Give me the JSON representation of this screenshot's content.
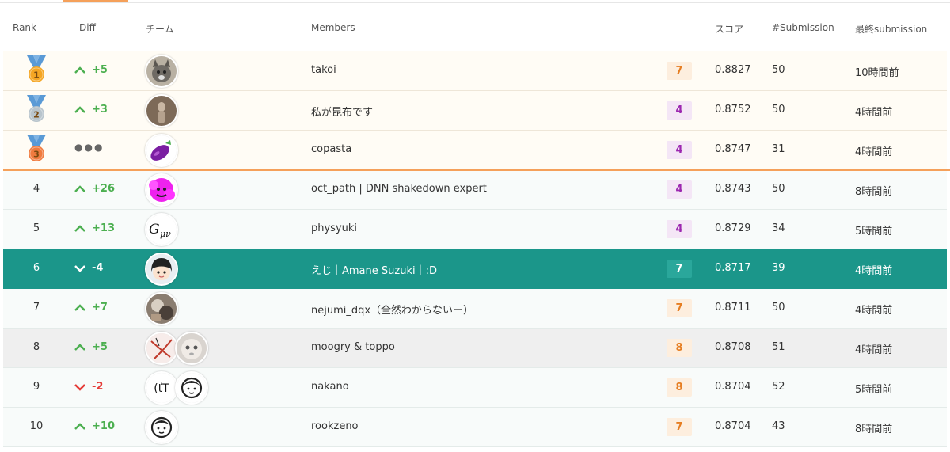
{
  "header": {
    "rank": "Rank",
    "diff": "Diff",
    "team": "チーム",
    "members": "Members",
    "score": "スコア",
    "submissions": "#Submission",
    "last_submission": "最終submission"
  },
  "rows": [
    {
      "rank": "1",
      "medal": "gold",
      "diff": "+5",
      "dir": "up",
      "members": "takoi",
      "badge": "7",
      "badge_color": "orange",
      "score": "0.8827",
      "subs": "50",
      "last": "10時間前",
      "avatars": [
        "cat"
      ]
    },
    {
      "rank": "2",
      "medal": "silver",
      "diff": "+3",
      "dir": "up",
      "members": "私が昆布です",
      "badge": "4",
      "badge_color": "purple",
      "score": "0.8752",
      "subs": "50",
      "last": "4時間前",
      "avatars": [
        "figure"
      ]
    },
    {
      "rank": "3",
      "medal": "bronze",
      "diff": "",
      "dir": "same",
      "members": "copasta",
      "badge": "4",
      "badge_color": "purple",
      "score": "0.8747",
      "subs": "31",
      "last": "4時間前",
      "avatars": [
        "eggplant"
      ]
    },
    {
      "rank": "4",
      "diff": "+26",
      "dir": "up",
      "members": "oct_path | DNN shakedown expert",
      "badge": "4",
      "badge_color": "purple",
      "score": "0.8743",
      "subs": "50",
      "last": "8時間前",
      "avatars": [
        "pink"
      ]
    },
    {
      "rank": "5",
      "diff": "+13",
      "dir": "up",
      "members": "physyuki",
      "badge": "4",
      "badge_color": "purple",
      "score": "0.8729",
      "subs": "34",
      "last": "5時間前",
      "avatars": [
        "g-mu-nu"
      ]
    },
    {
      "rank": "6",
      "diff": "-4",
      "dir": "down",
      "members": "えじ｜Amane Suzuki｜:D",
      "badge": "7",
      "badge_color": "teal",
      "score": "0.8717",
      "subs": "39",
      "last": "4時間前",
      "avatars": [
        "anime-face"
      ]
    },
    {
      "rank": "7",
      "diff": "+7",
      "dir": "up",
      "members": "nejumi_dqx（全然わからないー）",
      "badge": "7",
      "badge_color": "orange",
      "score": "0.8711",
      "subs": "50",
      "last": "4時間前",
      "avatars": [
        "photo"
      ]
    },
    {
      "rank": "8",
      "diff": "+5",
      "dir": "up",
      "members": "moogry & toppo",
      "badge": "8",
      "badge_color": "orange",
      "score": "0.8708",
      "subs": "51",
      "last": "4時間前",
      "avatars": [
        "sketch",
        "doll"
      ]
    },
    {
      "rank": "9",
      "diff": "-2",
      "dir": "down",
      "members": "nakano",
      "badge": "8",
      "badge_color": "orange",
      "score": "0.8704",
      "subs": "52",
      "last": "5時間前",
      "avatars": [
        "text-face",
        "face"
      ]
    },
    {
      "rank": "10",
      "diff": "+10",
      "dir": "up",
      "members": "rookzeno",
      "badge": "7",
      "badge_color": "orange",
      "score": "0.8704",
      "subs": "43",
      "last": "8時間前",
      "avatars": [
        "face"
      ]
    }
  ],
  "avatar_text": {
    "g-mu-nu": "Gμν",
    "text-face": "(ťΤ"
  },
  "colors": {
    "accent": "#f5a05a",
    "highlight": "#1b968a",
    "up": "#4caf50",
    "down": "#e53935"
  }
}
